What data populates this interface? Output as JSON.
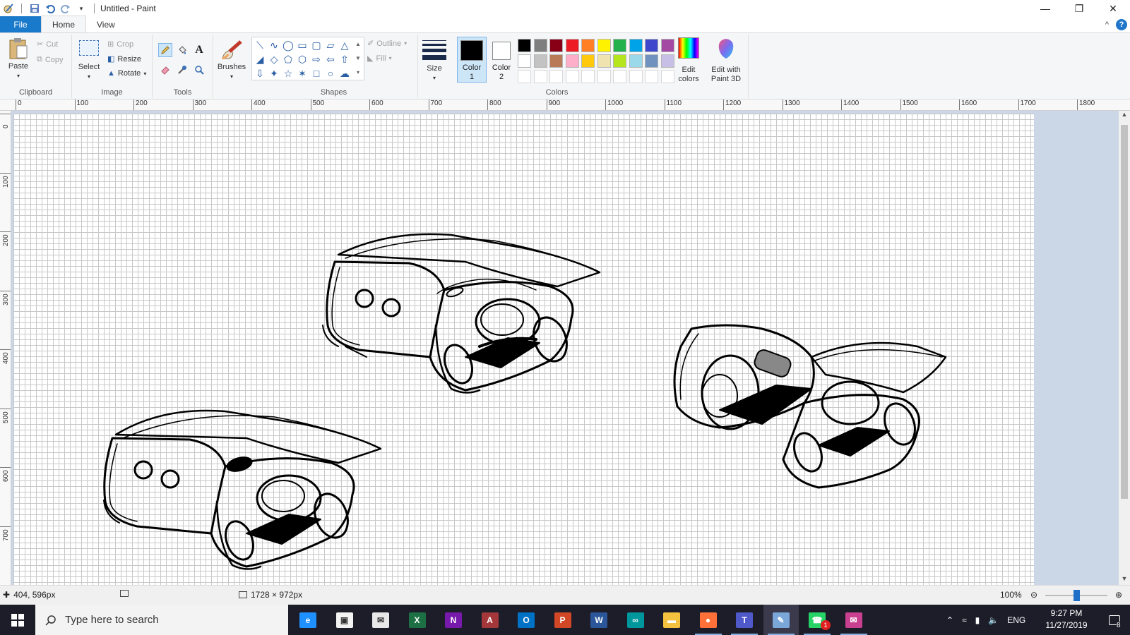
{
  "window": {
    "title": "Untitled - Paint",
    "controls": {
      "minimize": "—",
      "maximize": "❐",
      "close": "✕"
    }
  },
  "quick_access": {
    "save_icon": "save-icon",
    "undo_icon": "undo-icon",
    "redo_icon": "redo-icon"
  },
  "tabs": [
    {
      "label": "File"
    },
    {
      "label": "Home"
    },
    {
      "label": "View"
    }
  ],
  "help": {
    "collapse": "^",
    "help": "?"
  },
  "ribbon": {
    "clipboard": {
      "label": "Clipboard",
      "paste": "Paste",
      "cut": "Cut",
      "copy": "Copy"
    },
    "image": {
      "label": "Image",
      "select": "Select",
      "crop": "Crop",
      "resize": "Resize",
      "rotate": "Rotate"
    },
    "tools": {
      "label": "Tools",
      "text_tool": "A"
    },
    "brushes": {
      "label": "Brushes"
    },
    "shapes": {
      "label": "Shapes",
      "outline": "Outline",
      "fill": "Fill"
    },
    "size": {
      "label": "Size"
    },
    "colors": {
      "label": "Colors",
      "color1": {
        "label_line1": "Color",
        "label_line2": "1",
        "value": "#000000"
      },
      "color2": {
        "label_line1": "Color",
        "label_line2": "2",
        "value": "#ffffff"
      },
      "palette_row1": [
        "#000000",
        "#7f7f7f",
        "#880015",
        "#ed1c24",
        "#ff7f27",
        "#fff200",
        "#22b14c",
        "#00a2e8",
        "#3f48cc",
        "#a349a4"
      ],
      "palette_row2": [
        "#ffffff",
        "#c3c3c3",
        "#b97a57",
        "#ffaec9",
        "#ffc90e",
        "#efe4b0",
        "#b5e61d",
        "#99d9ea",
        "#7092be",
        "#c8bfe7"
      ],
      "palette_row3": [
        "#ffffff",
        "#ffffff",
        "#ffffff",
        "#ffffff",
        "#ffffff",
        "#ffffff",
        "#ffffff",
        "#ffffff",
        "#ffffff",
        "#ffffff"
      ],
      "edit_colors_line1": "Edit",
      "edit_colors_line2": "colors",
      "edit_3d_line1": "Edit with",
      "edit_3d_line2": "Paint 3D"
    }
  },
  "rulers": {
    "horizontal": [
      "0",
      "100",
      "200",
      "300",
      "400",
      "500",
      "600",
      "700",
      "800",
      "900",
      "1000",
      "1100",
      "1200",
      "1300",
      "1400",
      "1500",
      "1600",
      "1700",
      "1800"
    ],
    "vertical": [
      "0",
      "100",
      "200",
      "300",
      "400",
      "500",
      "600",
      "700"
    ]
  },
  "status": {
    "cursor_pos": "404, 596px",
    "canvas_size": "1728 × 972px",
    "zoom": "100%",
    "zoom_level": 1.0
  },
  "taskbar": {
    "search_placeholder": "Type here to search",
    "apps": [
      {
        "name": "edge",
        "letter": "e",
        "color": "#1e90ff",
        "running": false
      },
      {
        "name": "store",
        "letter": "▣",
        "color": "#f3f3f3",
        "running": false
      },
      {
        "name": "mail",
        "letter": "✉",
        "color": "#e8e8e8",
        "running": false
      },
      {
        "name": "excel",
        "letter": "X",
        "color": "#1d7044",
        "running": false
      },
      {
        "name": "onenote",
        "letter": "N",
        "color": "#7719aa",
        "running": false
      },
      {
        "name": "access",
        "letter": "A",
        "color": "#a4373a",
        "running": false
      },
      {
        "name": "outlook",
        "letter": "O",
        "color": "#0072c6",
        "running": false
      },
      {
        "name": "powerpoint",
        "letter": "P",
        "color": "#d24726",
        "running": false
      },
      {
        "name": "word",
        "letter": "W",
        "color": "#2b579a",
        "running": false
      },
      {
        "name": "arduino",
        "letter": "∞",
        "color": "#00979c",
        "running": false
      },
      {
        "name": "file-explorer",
        "letter": "▬",
        "color": "#f4c23e",
        "running": false
      },
      {
        "name": "firefox",
        "letter": "●",
        "color": "#ff7139",
        "running": true
      },
      {
        "name": "teams",
        "letter": "T",
        "color": "#5059c9",
        "running": true
      },
      {
        "name": "paint",
        "letter": "✎",
        "color": "#7aa6d8",
        "running": true,
        "active": true
      },
      {
        "name": "whatsapp",
        "letter": "☎",
        "color": "#25d366",
        "running": true,
        "badge": "1"
      },
      {
        "name": "messenger",
        "letter": "✉",
        "color": "#c8408f",
        "running": true
      }
    ],
    "tray": {
      "language": "ENG",
      "time": "9:27 PM",
      "date": "11/27/2019",
      "notifications": "8"
    }
  }
}
